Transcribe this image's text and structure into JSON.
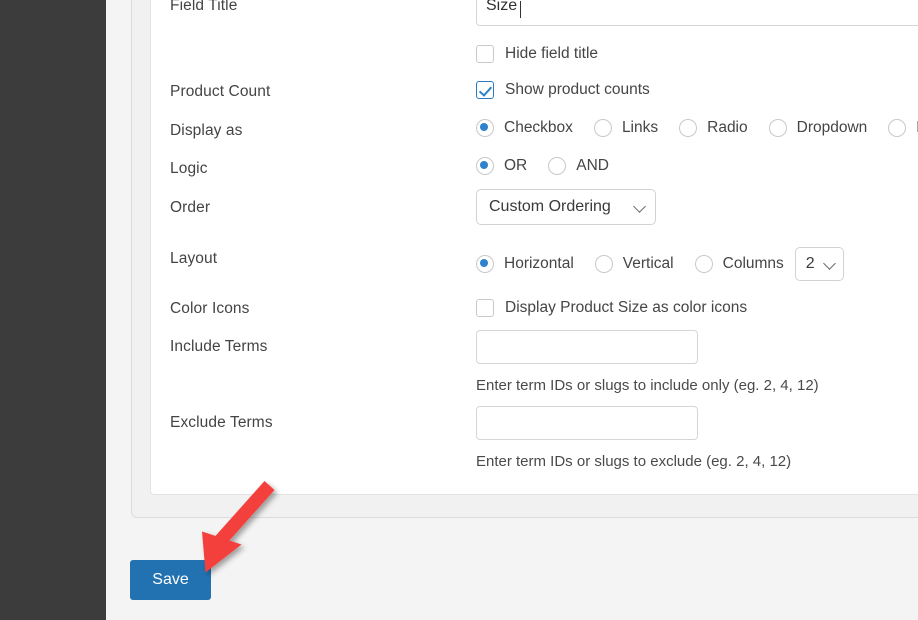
{
  "app": {
    "accent_blue": "#2271b1",
    "control_blue": "#2d83cd",
    "annotation_red": "#f4413c",
    "sidebar_color": "#3c3c3c",
    "panel_bg": "#f1f1f1",
    "card_bg": "#ffffff"
  },
  "form": {
    "rows": [
      {
        "label": "Field Title"
      },
      {
        "label": "Product Count"
      },
      {
        "label": "Display as"
      },
      {
        "label": "Logic"
      },
      {
        "label": "Order"
      },
      {
        "label": "Layout"
      },
      {
        "label": "Color Icons"
      },
      {
        "label": "Include Terms"
      },
      {
        "label": "Exclude Terms"
      }
    ],
    "field_title": {
      "value": "Size"
    },
    "hide_field_title": {
      "label": "Hide field title",
      "checked": false
    },
    "product_count": {
      "label": "Show product counts",
      "checked": true
    },
    "display_as": {
      "options": [
        {
          "label": "Checkbox",
          "checked": true
        },
        {
          "label": "Links",
          "checked": false
        },
        {
          "label": "Radio",
          "checked": false
        },
        {
          "label": "Dropdown",
          "checked": false
        },
        {
          "label": "Mu",
          "checked": false
        }
      ]
    },
    "logic": {
      "options": [
        {
          "label": "OR",
          "checked": true
        },
        {
          "label": "AND",
          "checked": false
        }
      ]
    },
    "order": {
      "selected": "Custom Ordering"
    },
    "layout": {
      "options": [
        {
          "label": "Horizontal",
          "checked": true
        },
        {
          "label": "Vertical",
          "checked": false
        },
        {
          "label": "Columns",
          "checked": false
        }
      ],
      "columns_selected": "2"
    },
    "color_icons": {
      "label": "Display Product Size as color icons",
      "checked": false
    },
    "include_terms": {
      "value": "",
      "hint": "Enter term IDs or slugs to include only (eg. 2, 4, 12)"
    },
    "exclude_terms": {
      "value": "",
      "hint": "Enter term IDs or slugs to exclude (eg. 2, 4, 12)"
    }
  },
  "footer": {
    "save_label": "Save"
  }
}
